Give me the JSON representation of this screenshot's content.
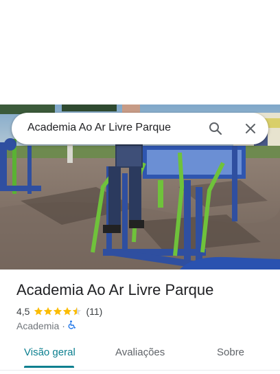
{
  "search": {
    "query": "Academia Ao Ar Livre Parque",
    "search_icon": "search-icon",
    "close_icon": "close-icon"
  },
  "place": {
    "name": "Academia Ao Ar Livre Parque",
    "rating": "4,5",
    "rating_stars": 4.5,
    "review_count": "(11)",
    "category": "Academia",
    "separator": "·",
    "accessibility_icon": "wheelchair-icon"
  },
  "tabs": [
    {
      "label": "Visão geral",
      "active": true
    },
    {
      "label": "Avaliações",
      "active": false
    },
    {
      "label": "Sobre",
      "active": false
    }
  ],
  "colors": {
    "accent": "#0b7f8f",
    "star": "#fbbc04",
    "accessibility": "#1a73e8"
  }
}
